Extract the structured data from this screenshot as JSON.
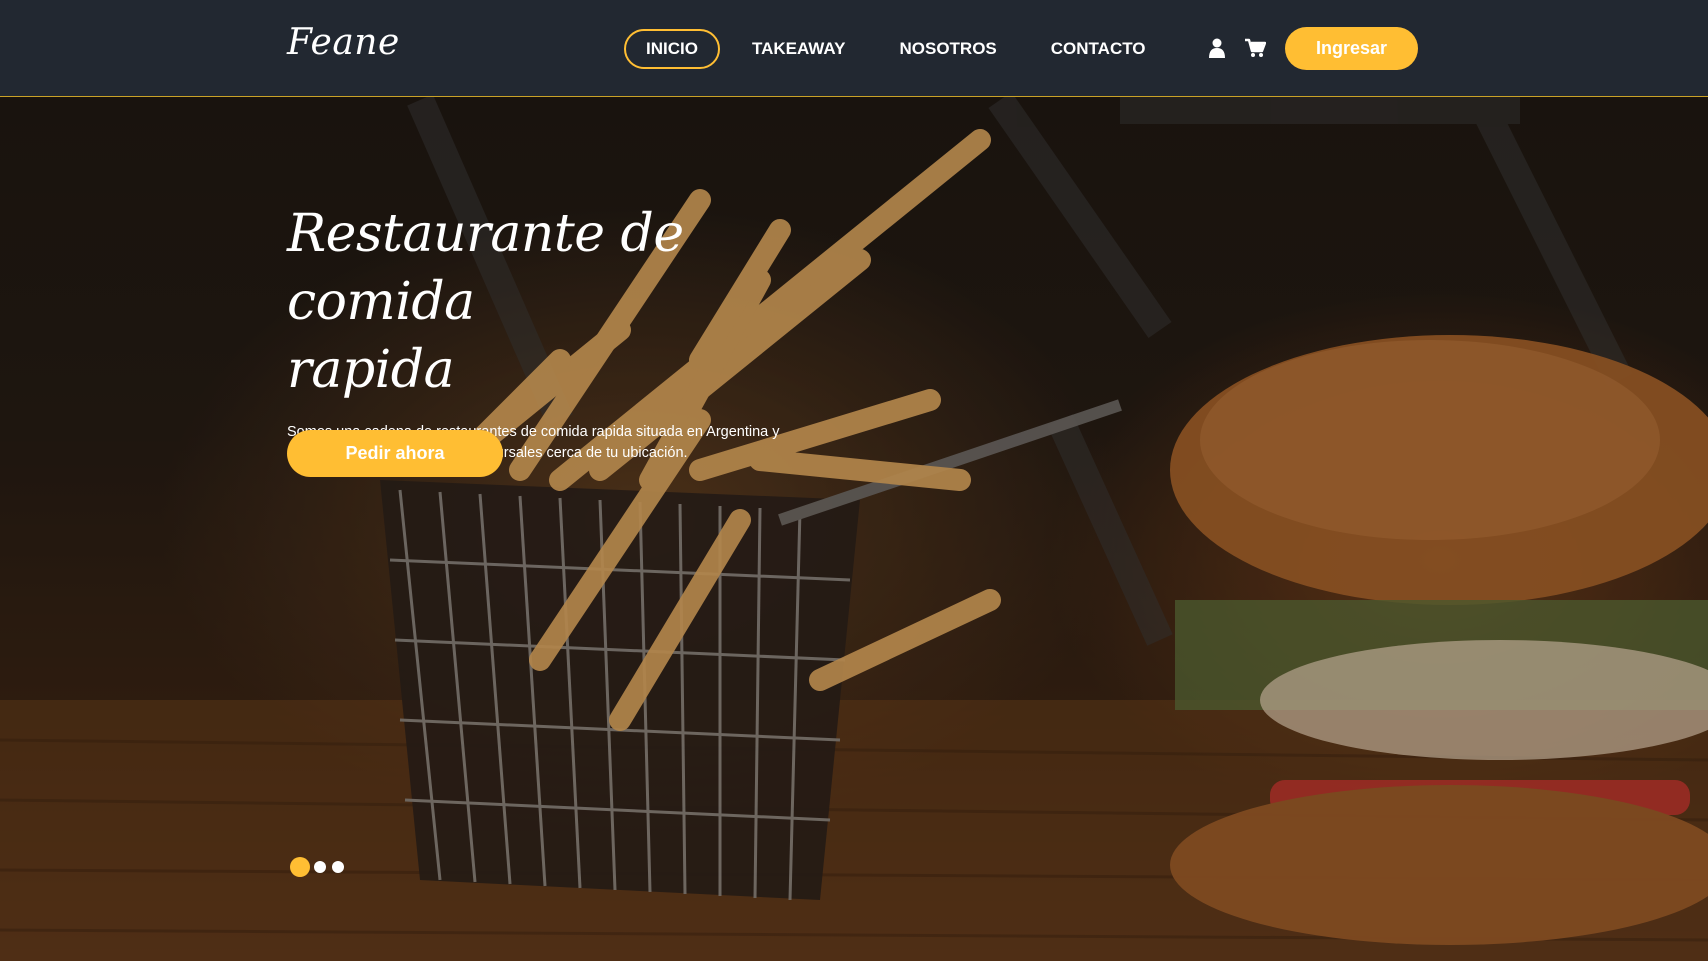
{
  "header": {
    "logo": "Feane",
    "nav": [
      {
        "label": "INICIO",
        "active": true
      },
      {
        "label": "TAKEAWAY",
        "active": false
      },
      {
        "label": "NOSOTROS",
        "active": false
      },
      {
        "label": "CONTACTO",
        "active": false
      }
    ],
    "icons": {
      "user": "user-icon",
      "cart": "cart-icon"
    },
    "login_label": "Ingresar"
  },
  "hero": {
    "title_line1": "Restaurante de comida",
    "title_line2": "rapida",
    "description": "Somos una cadena de restaurantes de comida rapida situada en Argentina y Colombia, revisá si tenemos sucursales cerca de tu ubicación.",
    "cta_label": "Pedir ahora",
    "slides": [
      {
        "active": true
      },
      {
        "active": false
      },
      {
        "active": false
      }
    ]
  },
  "colors": {
    "header_bg": "#222831",
    "accent": "#ffbe33",
    "text": "#ffffff"
  }
}
